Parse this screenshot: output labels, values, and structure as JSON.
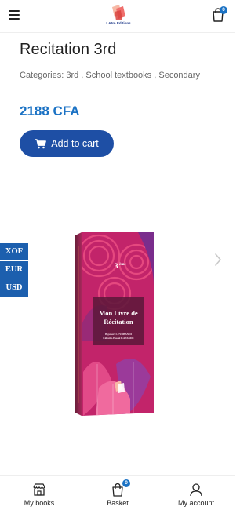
{
  "header": {
    "logo_text": "LANA Éditions",
    "cart_count": "0"
  },
  "product": {
    "title": "Recitation 3rd",
    "categories_label": "Categories:",
    "categories": [
      "3rd",
      "School textbooks",
      "Secondary"
    ],
    "price": "2188 CFA",
    "add_to_cart_label": "Add to cart"
  },
  "currency_switcher": [
    "XOF",
    "EUR",
    "USD"
  ],
  "book_cover": {
    "level": "3",
    "level_sup": "ème",
    "title_line1": "Mon Livre de",
    "title_line2": "Récitation",
    "author1": "Bigobert LEYOBANDI",
    "author2": "Célestin-Pascal KAPANDE"
  },
  "bottom_nav": {
    "books_label": "My books",
    "basket_label": "Basket",
    "basket_count": "0",
    "account_label": "My account"
  },
  "colors": {
    "accent": "#1b72c4",
    "button": "#1e4fa5",
    "currency": "#1c5fae"
  }
}
